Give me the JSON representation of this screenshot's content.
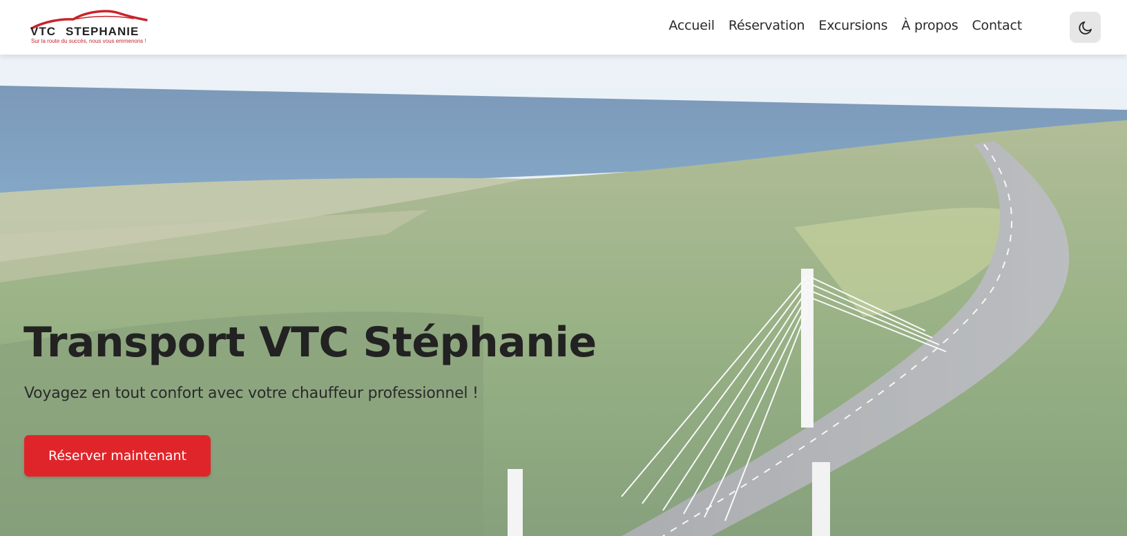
{
  "brand": {
    "logo_text_left": "VTC",
    "logo_text_right": "STEPHANIE",
    "tagline": "Sur la route du succès, nous vous emmenons !",
    "logo_arc_color": "#c8232b"
  },
  "nav": {
    "items": [
      {
        "label": "Accueil"
      },
      {
        "label": "Réservation"
      },
      {
        "label": "Excursions"
      },
      {
        "label": "À propos"
      },
      {
        "label": "Contact"
      }
    ],
    "theme_toggle_icon": "moon-icon"
  },
  "hero": {
    "title": "Transport VTC Stéphanie",
    "subtitle": "Voyagez en tout confort avec votre chauffeur professionnel !",
    "cta_label": "Réserver maintenant",
    "background_image": "aerial-coastal-highway-bridge",
    "cta_color": "#e0252a"
  }
}
